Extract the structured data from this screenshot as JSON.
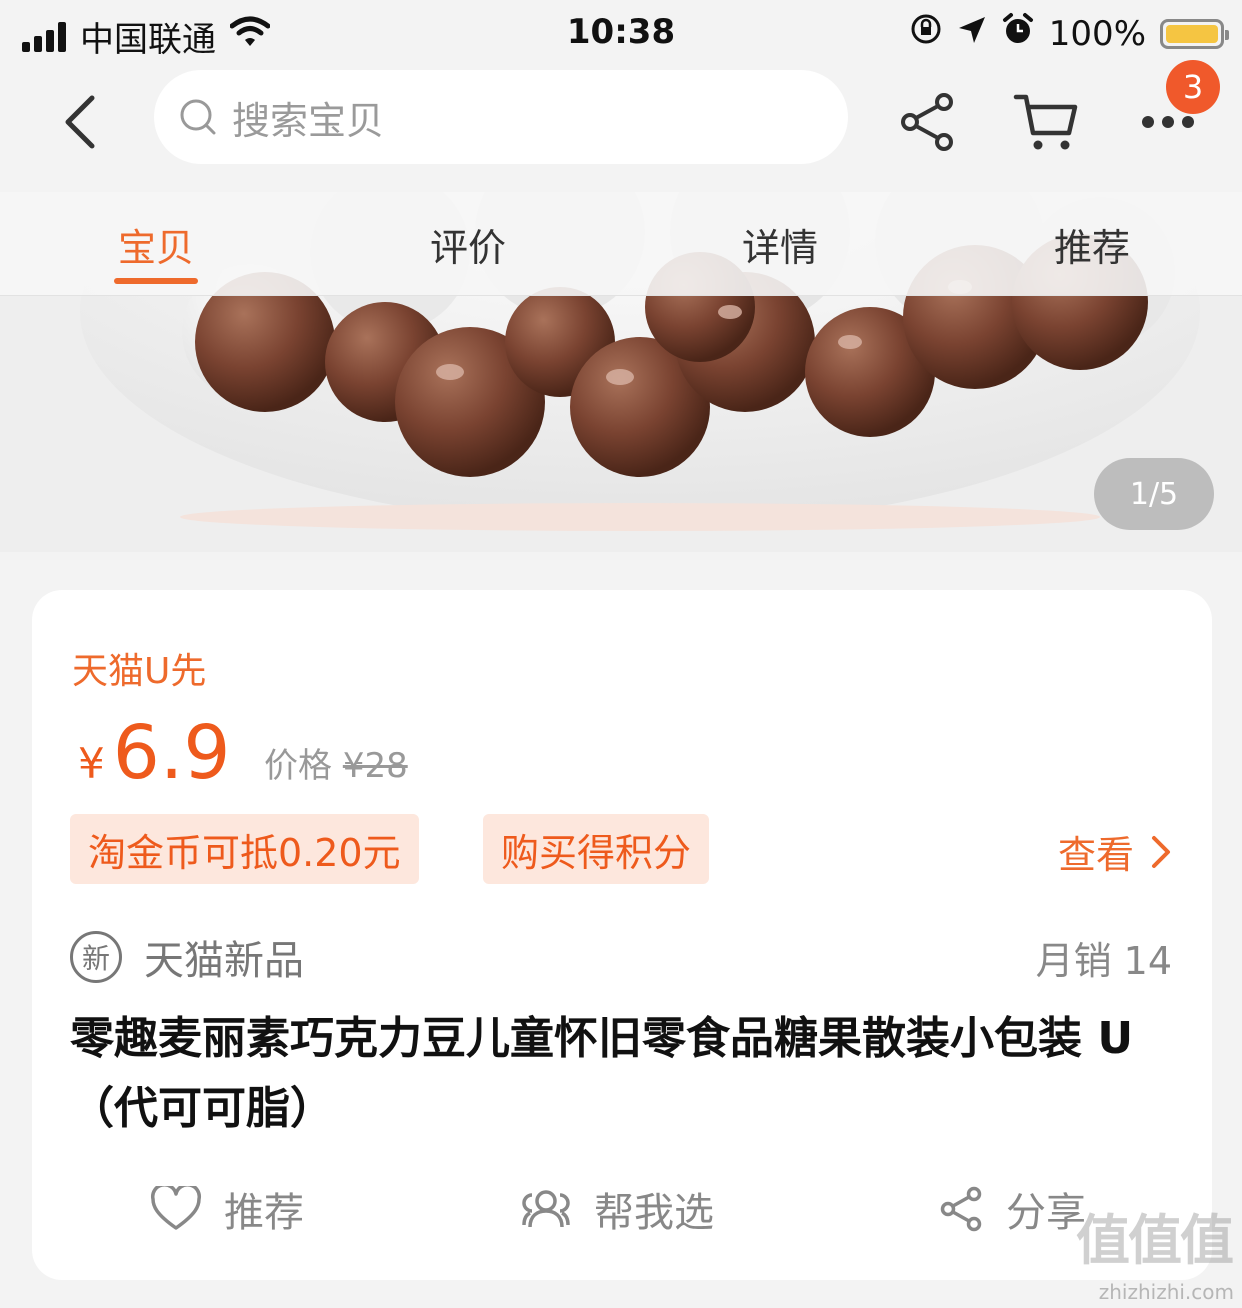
{
  "status_bar": {
    "carrier": "中国联通",
    "time": "10:38",
    "battery": "100%"
  },
  "nav": {
    "search_placeholder": "搜索宝贝",
    "cart_badge": "3"
  },
  "tabs": [
    {
      "label": "宝贝",
      "active": true
    },
    {
      "label": "评价",
      "active": false
    },
    {
      "label": "详情",
      "active": false
    },
    {
      "label": "推荐",
      "active": false
    }
  ],
  "gallery": {
    "pager": "1/5"
  },
  "product": {
    "brand_label": "天猫U先",
    "price_symbol": "¥",
    "price": "6.9",
    "original_label": "价格",
    "original_price": "¥28",
    "tags": [
      "淘金币可抵0.20元",
      "购买得积分"
    ],
    "view_label": "查看",
    "new_badge": "新",
    "new_label": "天猫新品",
    "monthly_sales": "月销 14",
    "title": "零趣麦丽素巧克力豆儿童怀旧零食品糖果散装小包装 U（代可可脂）"
  },
  "actions": [
    {
      "label": "推荐",
      "icon": "heart-icon"
    },
    {
      "label": "帮我选",
      "icon": "people-icon"
    },
    {
      "label": "分享",
      "icon": "share-icon"
    }
  ],
  "watermark": {
    "text": "值值值",
    "url": "zhizhizhi.com"
  },
  "colors": {
    "accent": "#ee6a2c",
    "price": "#ee5a1c",
    "badge": "#f0592b",
    "tag_bg": "#fde7dd"
  }
}
